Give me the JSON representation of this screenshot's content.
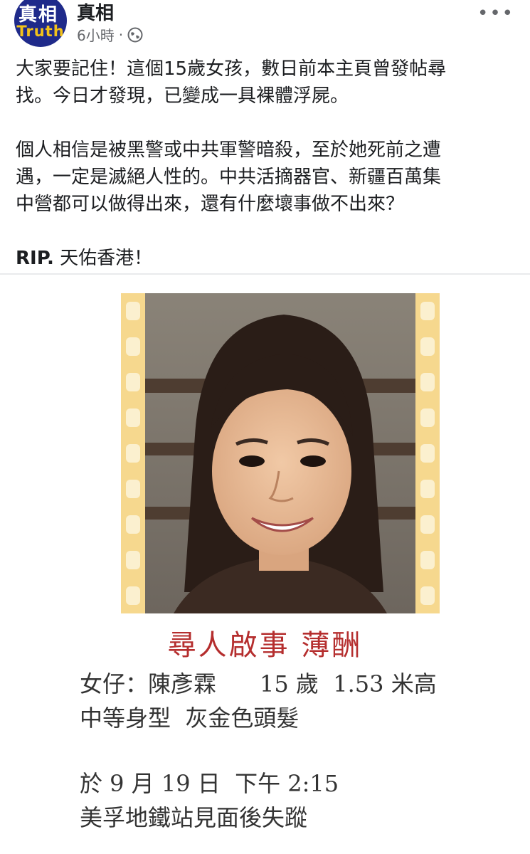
{
  "header": {
    "avatar_top": "真相",
    "avatar_bottom": "Truth",
    "page_name": "真相",
    "time": "6小時",
    "dot": "·",
    "more": "•••"
  },
  "post": {
    "line1": "大家要記住！這個15歲女孩，數日前本主頁曾發帖尋",
    "line2": "找。今日才發現，已變成一具裸體浮屍。",
    "line3": "個人相信是被黑警或中共軍警暗殺，至於她死前之遭",
    "line4": "遇，一定是滅絕人性的。中共活摘器官、新疆百萬集",
    "line5": "中營都可以做得出來，還有什麼壞事做不出來？",
    "line6_bold": "RIP.",
    "line6_rest": " 天佑香港！"
  },
  "poster": {
    "title": "尋人啟事  薄酬",
    "details1": "女仔：陳彥霖      15 歲  1.53 米高",
    "details2": "中等身型  灰金色頭髮",
    "details3": "於 9 月 19 日  下午 2:15",
    "details4": "美孚地鐵站見面後失蹤"
  },
  "colors": {
    "avatar_bg": "#1f2a8a",
    "avatar_text": "#f2c21a",
    "poster_title": "#b52e2e",
    "film_strip": "#f6d88e"
  },
  "icons": [
    "globe-icon",
    "more-options-icon"
  ]
}
